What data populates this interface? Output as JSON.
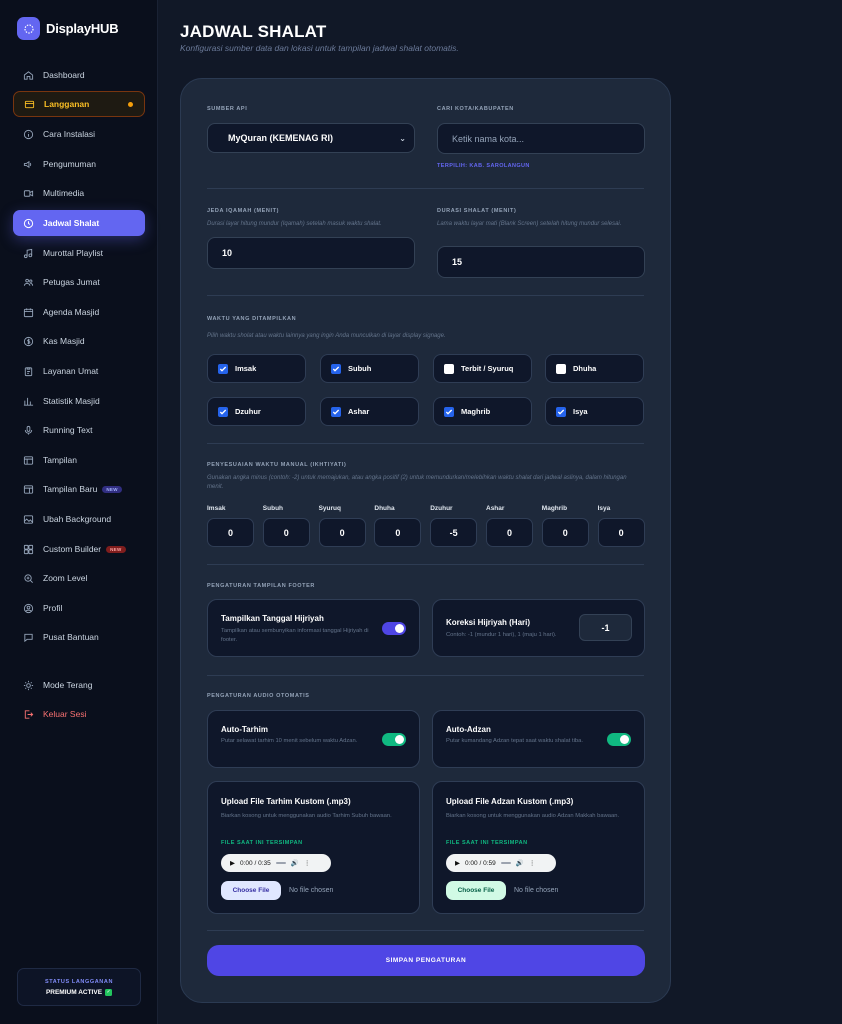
{
  "brand": {
    "name": "DisplayHUB"
  },
  "sidebar": {
    "items": [
      {
        "label": "Dashboard",
        "icon": "home-icon"
      },
      {
        "label": "Langganan",
        "icon": "card-icon"
      },
      {
        "label": "Cara Instalasi",
        "icon": "info-icon"
      },
      {
        "label": "Pengumuman",
        "icon": "megaphone-icon"
      },
      {
        "label": "Multimedia",
        "icon": "video-icon"
      },
      {
        "label": "Jadwal Shalat",
        "icon": "clock-icon"
      },
      {
        "label": "Murottal Playlist",
        "icon": "music-icon"
      },
      {
        "label": "Petugas Jumat",
        "icon": "users-icon"
      },
      {
        "label": "Agenda Masjid",
        "icon": "calendar-icon"
      },
      {
        "label": "Kas Masjid",
        "icon": "dollar-icon"
      },
      {
        "label": "Layanan Umat",
        "icon": "clipboard-icon"
      },
      {
        "label": "Statistik Masjid",
        "icon": "bar-chart-icon"
      },
      {
        "label": "Running Text",
        "icon": "mic-icon"
      },
      {
        "label": "Tampilan",
        "icon": "layout-icon"
      },
      {
        "label": "Tampilan Baru",
        "icon": "layout-new-icon",
        "badge": "NEW"
      },
      {
        "label": "Ubah Background",
        "icon": "image-icon"
      },
      {
        "label": "Custom Builder",
        "icon": "builder-icon",
        "badge": "NEW"
      },
      {
        "label": "Zoom Level",
        "icon": "zoom-icon"
      },
      {
        "label": "Profil",
        "icon": "user-icon"
      },
      {
        "label": "Pusat Bantuan",
        "icon": "chat-icon"
      },
      {
        "label": "Mode Terang",
        "icon": "sun-icon"
      },
      {
        "label": "Keluar Sesi",
        "icon": "logout-icon"
      }
    ],
    "status": {
      "label": "STATUS LANGGANAN",
      "value": "PREMIUM ACTIVE"
    }
  },
  "page": {
    "title": "JADWAL SHALAT",
    "subtitle": "Konfigurasi sumber data dan lokasi untuk tampilan jadwal shalat otomatis."
  },
  "form": {
    "source": {
      "label": "SUMBER API",
      "value": "MyQuran (KEMENAG RI)"
    },
    "city": {
      "label": "CARI KOTA/KABUPATEN",
      "placeholder": "Ketik nama kota...",
      "selected": "TERPILIH: KAB. SAROLANGUN"
    },
    "iqamah": {
      "label": "JEDA IQAMAH (MENIT)",
      "hint": "Durasi layar hitung mundur (Iqamah) setelah masuk waktu shalat.",
      "value": "10"
    },
    "prayer_duration": {
      "label": "DURASI SHALAT (MENIT)",
      "hint": "Lama waktu layar mati (Blank Screen) setelah hitung mundur selesai.",
      "value": "15"
    },
    "times": {
      "label": "WAKTU YANG DITAMPILKAN",
      "hint": "Pilih waktu sholat atau waktu lainnya yang ingin Anda munculkan di layar display signage.",
      "items": [
        {
          "label": "Imsak",
          "checked": true
        },
        {
          "label": "Subuh",
          "checked": true
        },
        {
          "label": "Terbit / Syuruq",
          "checked": false
        },
        {
          "label": "Dhuha",
          "checked": false
        },
        {
          "label": "Dzuhur",
          "checked": true
        },
        {
          "label": "Ashar",
          "checked": true
        },
        {
          "label": "Maghrib",
          "checked": true
        },
        {
          "label": "Isya",
          "checked": true
        }
      ]
    },
    "adjust": {
      "label": "PENYESUAIAN WAKTU MANUAL (IKHTIYATI)",
      "hint": "Gunakan angka minus (contoh: -2) untuk memajukan, atau angka positif (2) untuk memundurkan/melebihkan waktu shalat dari jadwal aslinya, dalam hitungan menit.",
      "items": [
        {
          "label": "Imsak",
          "value": "0"
        },
        {
          "label": "Subuh",
          "value": "0"
        },
        {
          "label": "Syuruq",
          "value": "0"
        },
        {
          "label": "Dhuha",
          "value": "0"
        },
        {
          "label": "Dzuhur",
          "value": "-5"
        },
        {
          "label": "Ashar",
          "value": "0"
        },
        {
          "label": "Maghrib",
          "value": "0"
        },
        {
          "label": "Isya",
          "value": "0"
        }
      ]
    },
    "footer": {
      "label": "PENGATURAN TAMPILAN FOOTER",
      "hijri_toggle": {
        "title": "Tampilkan Tanggal Hijriyah",
        "desc": "Tampilkan atau sembunyikan informasi tanggal Hijriyah di footer.",
        "on": true
      },
      "hijri_fix": {
        "title": "Koreksi Hijriyah (Hari)",
        "desc": "Contoh: -1 (mundur 1 hari), 1 (maju 1 hari).",
        "value": "-1"
      }
    },
    "audio": {
      "label": "PENGATURAN AUDIO OTOMATIS",
      "tarhim": {
        "title": "Auto-Tarhim",
        "desc": "Putar selawat tarhim 10 menit sebelum waktu Adzan.",
        "on": true
      },
      "adzan": {
        "title": "Auto-Adzan",
        "desc": "Putar kumandang Adzan tepat saat waktu shalat tiba.",
        "on": true
      },
      "upload_tarhim": {
        "title": "Upload File Tarhim Kustom (.mp3)",
        "desc": "Biarkan kosong untuk menggunakan audio Tarhim Subuh bawaan.",
        "saved_label": "FILE SAAT INI TERSIMPAN",
        "time": "0:00 / 0:35",
        "button": "Choose File",
        "nofile": "No file chosen"
      },
      "upload_adzan": {
        "title": "Upload File Adzan Kustom (.mp3)",
        "desc": "Biarkan kosong untuk menggunakan audio Adzan Makkah bawaan.",
        "saved_label": "FILE SAAT INI TERSIMPAN",
        "time": "0:00 / 0:59",
        "button": "Choose File",
        "nofile": "No file chosen"
      }
    },
    "save": "SIMPAN PENGATURAN"
  },
  "colors": {
    "accent": "#6366f1",
    "success": "#10b981",
    "warning": "#f59e0b",
    "danger": "#f87171"
  }
}
